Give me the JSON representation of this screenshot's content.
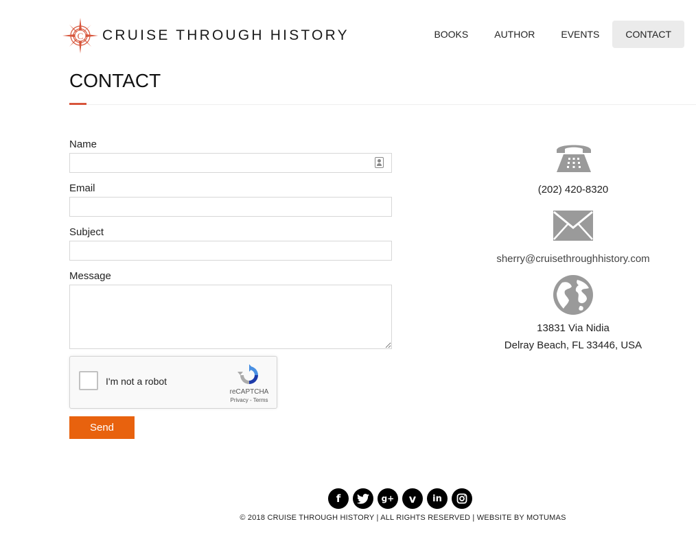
{
  "header": {
    "logo_text": "CRUISE THROUGH HISTORY",
    "nav": [
      {
        "label": "BOOKS",
        "active": false
      },
      {
        "label": "AUTHOR",
        "active": false
      },
      {
        "label": "EVENTS",
        "active": false
      },
      {
        "label": "CONTACT",
        "active": true
      }
    ]
  },
  "page": {
    "title": "CONTACT"
  },
  "form": {
    "name_label": "Name",
    "name_value": "",
    "email_label": "Email",
    "email_value": "",
    "subject_label": "Subject",
    "subject_value": "",
    "message_label": "Message",
    "message_value": "",
    "recaptcha": {
      "label": "I'm not a robot",
      "brand": "reCAPTCHA",
      "links": "Privacy - Terms"
    },
    "send_label": "Send"
  },
  "contact_info": {
    "phone": "(202) 420-8320",
    "email": "sherry@cruisethroughhistory.com",
    "address_line1": "13831 Via Nidia",
    "address_line2": "Delray Beach, FL   33446, USA"
  },
  "footer": {
    "social": [
      "facebook-icon",
      "twitter-icon",
      "google-plus-icon",
      "vimeo-icon",
      "linkedin-icon",
      "instagram-icon"
    ],
    "copyright": "© 2018 CRUISE THROUGH HISTORY | ALL RIGHTS RESERVED | WEBSITE BY MOTUMAS"
  },
  "colors": {
    "accent": "#d7553b",
    "button": "#e8620e",
    "icon_gray": "#9a9a9a"
  }
}
